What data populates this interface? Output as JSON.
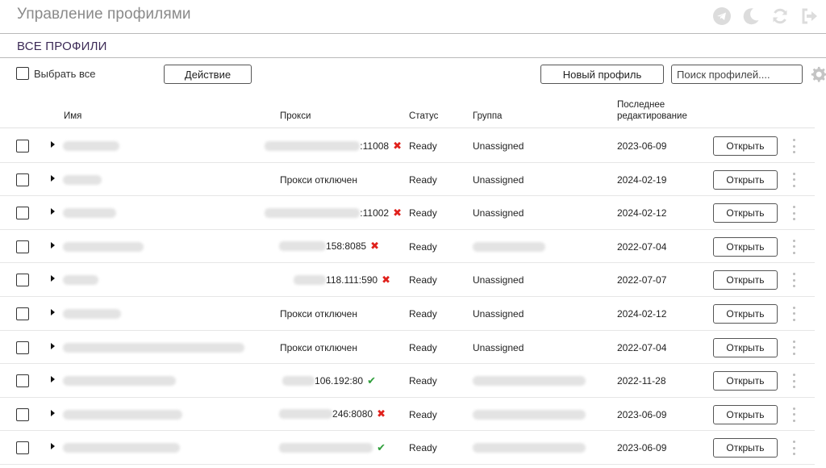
{
  "app": {
    "title": "Управление профилями"
  },
  "top_icons": [
    "telegram-icon",
    "moon-icon",
    "refresh-icon",
    "logout-icon"
  ],
  "section": {
    "title": "ВСЕ ПРОФИЛИ"
  },
  "toolbar": {
    "select_all_label": "Выбрать все",
    "action_label": "Действие",
    "new_profile_label": "Новый профиль",
    "search_placeholder": "Поиск профилей...."
  },
  "table": {
    "headers": {
      "name": "Имя",
      "proxy": "Прокси",
      "status": "Статус",
      "group": "Группа",
      "edited": "Последнее редактирование"
    },
    "open_label": "Открыть",
    "rows": [
      {
        "proxy": ":11008",
        "proxy_ok": false,
        "status": "Ready",
        "group": "Unassigned",
        "edited": "2023-06-09"
      },
      {
        "proxy": "Прокси отключен",
        "proxy_off": true,
        "status": "Ready",
        "group": "Unassigned",
        "edited": "2024-02-19"
      },
      {
        "proxy": ":11002",
        "proxy_ok": false,
        "status": "Ready",
        "group": "Unassigned",
        "edited": "2024-02-12"
      },
      {
        "proxy": "158:8085",
        "proxy_ok": false,
        "status": "Ready",
        "group": "",
        "edited": "2022-07-04"
      },
      {
        "proxy": "118.111:590",
        "proxy_ok": false,
        "status": "Ready",
        "group": "Unassigned",
        "edited": "2022-07-07"
      },
      {
        "proxy": "Прокси отключен",
        "proxy_off": true,
        "status": "Ready",
        "group": "Unassigned",
        "edited": "2024-02-12"
      },
      {
        "proxy": "Прокси отключен",
        "proxy_off": true,
        "status": "Ready",
        "group": "Unassigned",
        "edited": "2022-07-04"
      },
      {
        "proxy": "106.192:80",
        "proxy_ok": true,
        "status": "Ready",
        "group": "",
        "edited": "2022-11-28"
      },
      {
        "proxy": "246:8080",
        "proxy_ok": false,
        "status": "Ready",
        "group": "",
        "edited": "2023-06-09"
      },
      {
        "proxy": "",
        "proxy_ok": true,
        "status": "Ready",
        "group": "",
        "edited": "2023-06-09"
      }
    ]
  },
  "colors": {
    "accent": "#3c2a56",
    "error": "#e0211c",
    "ok": "#2e9e3a",
    "icon_gray": "#d9d9d9"
  }
}
